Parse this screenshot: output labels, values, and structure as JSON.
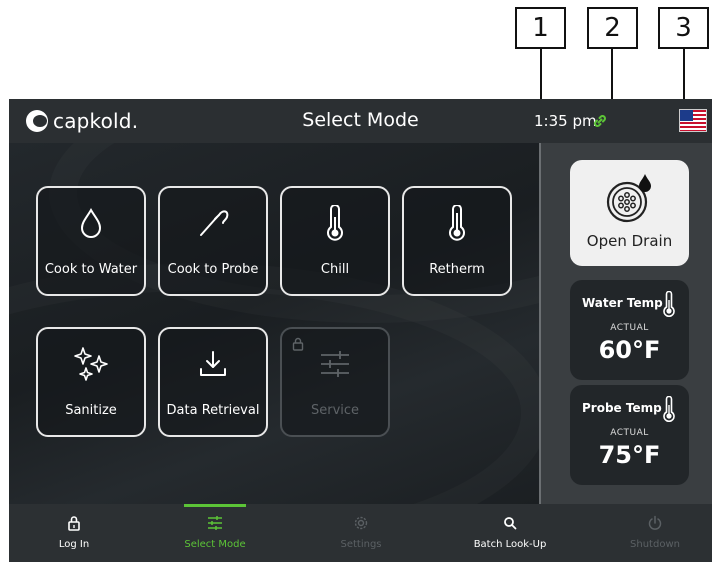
{
  "callouts": [
    "1",
    "2",
    "3"
  ],
  "header": {
    "brand": "capkold.",
    "title": "Select Mode",
    "time": "1:35 pm",
    "link_color": "#5cc437"
  },
  "modes": [
    {
      "label": "Cook to Water",
      "icon": "droplet-icon",
      "enabled": true
    },
    {
      "label": "Cook to Probe",
      "icon": "probe-icon",
      "enabled": true
    },
    {
      "label": "Chill",
      "icon": "thermometer-icon",
      "enabled": true
    },
    {
      "label": "Retherm",
      "icon": "thermometer-icon",
      "enabled": true
    },
    {
      "label": "Sanitize",
      "icon": "sparkle-icon",
      "enabled": true
    },
    {
      "label": "Data Retrieval",
      "icon": "download-icon",
      "enabled": true
    },
    {
      "label": "Service",
      "icon": "sliders-icon",
      "enabled": false,
      "locked": true
    }
  ],
  "side": {
    "drain_label": "Open Drain",
    "water": {
      "title": "Water Temp",
      "actual_label": "ACTUAL",
      "value": "60°F"
    },
    "probe": {
      "title": "Probe Temp",
      "actual_label": "ACTUAL",
      "value": "75°F"
    }
  },
  "nav": {
    "login": "Log In",
    "select_mode": "Select Mode",
    "settings": "Settings",
    "batch": "Batch Look-Up",
    "shutdown": "Shutdown",
    "accent": "#5cc437"
  }
}
